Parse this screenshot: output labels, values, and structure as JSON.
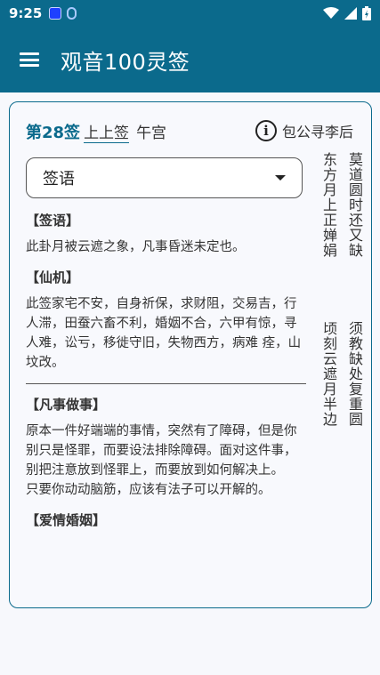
{
  "status": {
    "time": "9:25"
  },
  "app_bar": {
    "title": "观音100灵签"
  },
  "card": {
    "sign_number": "第28签",
    "sign_rank": "上上签",
    "palace": "午宫",
    "info_label": "包公寻李后",
    "info_icon_glyph": "i",
    "dropdown_value": "签语",
    "poem_columns": [
      "东方月上正婵娟",
      "莫道圆时还又缺",
      "顷刻云遮月半边",
      "须教缺处复重圆"
    ],
    "sections": [
      {
        "head": "【签语】",
        "text": "此卦月被云遮之象，凡事昏迷未定也。"
      },
      {
        "head": "【仙机】",
        "text": "此签家宅不安，自身祈保，求财阻，交易吉，行人滞，田蚕六畜不利，婚姻不合，六甲有惊，寻人难，讼亏，移徙守旧，失物西方，病难 痊，山坟改。"
      },
      {
        "head": "【凡事做事】",
        "text": "原本一件好端端的事情，突然有了障碍，但是你别只是怪罪，而要设法排除障碍。面对这件事，别把注意放到怪罪上，而要放到如何解决上。\n只要你动动脑筋，应该有法子可以开解的。"
      },
      {
        "head": "【爱情婚姻】",
        "text": ""
      }
    ]
  }
}
